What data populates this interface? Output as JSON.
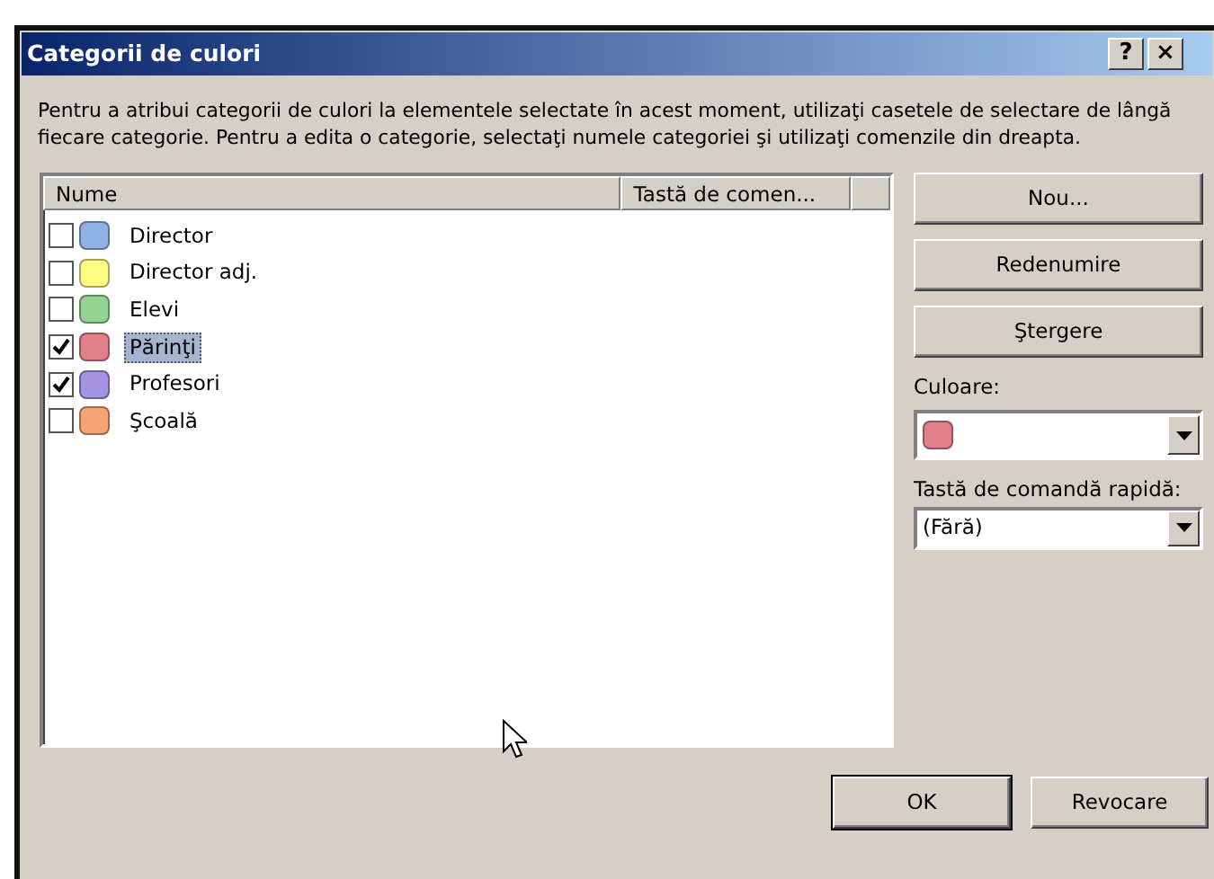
{
  "window": {
    "title": "Categorii de culori",
    "title_buttons": [
      "?",
      "×"
    ]
  },
  "description": "Pentru a atribui categorii de culori la elementele selectate în acest moment, utilizaţi casetele de selectare de lângă fiecare categorie. Pentru a edita o categorie, selectaţi numele categoriei şi utilizaţi comenzile din dreapta.",
  "table": {
    "columns": [
      "Nume",
      "Tastă de comen..."
    ],
    "rows": [
      {
        "name": "Director",
        "color": "#8fb1e3",
        "checked": false,
        "selected": false
      },
      {
        "name": "Director adj.",
        "color": "#fdfd84",
        "checked": false,
        "selected": false
      },
      {
        "name": "Elevi",
        "color": "#93d394",
        "checked": false,
        "selected": false
      },
      {
        "name": "Părinţi",
        "color": "#e2808a",
        "checked": true,
        "selected": true
      },
      {
        "name": "Profesori",
        "color": "#a493e0",
        "checked": true,
        "selected": false
      },
      {
        "name": "Şcoală",
        "color": "#f4a474",
        "checked": false,
        "selected": false
      }
    ]
  },
  "side_buttons": [
    "Nou...",
    "Redenumire",
    "Ştergere"
  ],
  "color_field": {
    "label": "Culoare:",
    "color": "#e2808a"
  },
  "shortcut_field": {
    "label": "Tastă de comandă rapidă:",
    "value": "(Fără)"
  },
  "buttons": [
    {
      "label": "OK",
      "default": true
    },
    {
      "label": "Revocare",
      "default": false
    }
  ]
}
